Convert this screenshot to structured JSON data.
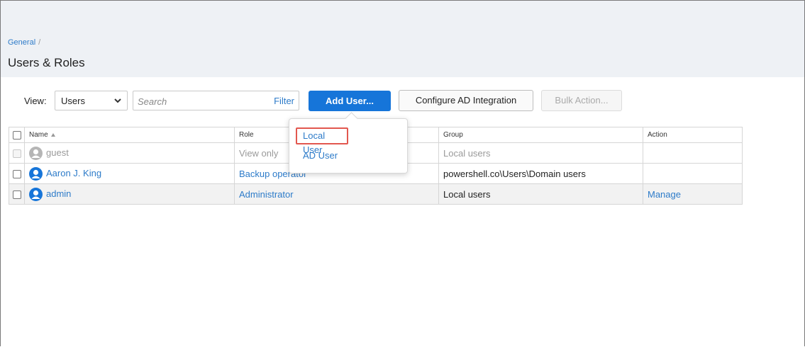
{
  "header": {
    "breadcrumb": "General",
    "breadcrumb_sep": "/",
    "title": "Users & Roles"
  },
  "toolbar": {
    "view_label": "View:",
    "view_value": "Users",
    "search_placeholder": "Search",
    "filter_label": "Filter",
    "add_user_label": "Add User...",
    "configure_ad_label": "Configure AD Integration",
    "bulk_action_label": "Bulk Action..."
  },
  "dropdown": {
    "items": [
      {
        "label": "Local User"
      },
      {
        "label": "AD User"
      }
    ]
  },
  "table": {
    "columns": {
      "name": "Name",
      "role": "Role",
      "group": "Group",
      "action": "Action"
    },
    "rows": [
      {
        "name": "guest",
        "role": "View only",
        "group": "Local users",
        "action": ""
      },
      {
        "name": "Aaron J. King",
        "role": "Backup operator",
        "group": "powershell.co\\Users\\Domain users",
        "action": ""
      },
      {
        "name": "admin",
        "role": "Administrator",
        "group": "Local users",
        "action": "Manage"
      }
    ]
  },
  "colors": {
    "accent": "#1675d9",
    "link": "#2d7bc9",
    "highlight": "#e2574f",
    "header_bg": "#eef1f5"
  },
  "icons": [
    "chevron-down-icon",
    "sort-asc-icon",
    "user-avatar-icon"
  ]
}
